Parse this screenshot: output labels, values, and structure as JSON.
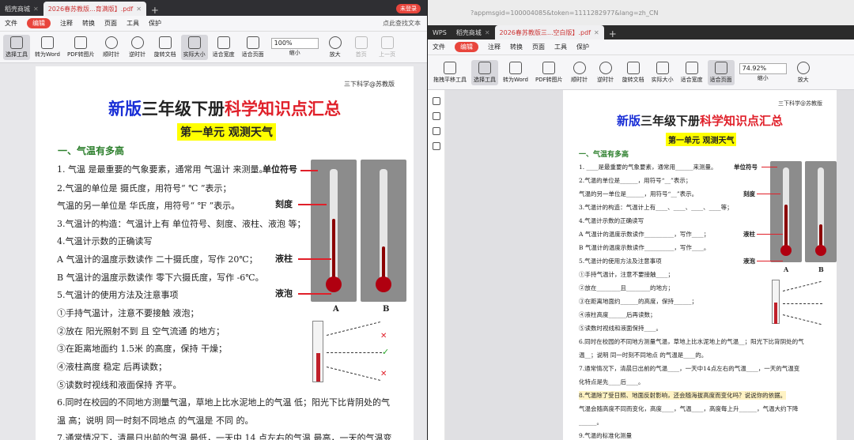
{
  "left": {
    "tabs": [
      "稻壳商城",
      "2026春苏教版...育满版】.pdf"
    ],
    "login": "未登录",
    "menu": [
      "文件",
      "编辑",
      "注释",
      "转换",
      "页面",
      "工具",
      "保护"
    ],
    "search": "点此查找文本",
    "tools": [
      "选择工具",
      "转为Word",
      "PDF转图片",
      "顺时针",
      "逆时针",
      "旋转文档",
      "实际大小",
      "适合宽度",
      "适合页面",
      "缩小",
      "放大",
      "首页",
      "上一页"
    ],
    "zoom": "100%",
    "doc": {
      "header": "三下科学@苏教版",
      "title_a": "新版",
      "title_b": "三年级下册",
      "title_c": "科学知识点汇总",
      "unit": "第一单元  观测天气",
      "section": "一、气温有多高",
      "lines": [
        "1.  气温 是最重要的气象要素，通常用 气温计 来测量。",
        "2.气温的单位是 摄氏度，用符号“ ℃ ”表示；",
        "   气温的另一单位是 华氏度，用符号“ ℉ ”表示。",
        "3.气温计的构造：气温计上有 单位符号、刻度、液柱、液泡 等；",
        "4.气温计示数的正确读写",
        "   A 气温计的温度示数读作 二十摄氏度，写作 20℃；",
        "   B 气温计的温度示数读作 零下六摄氏度，写作 -6℃。",
        "5.气温计的使用方法及注意事项",
        "   ①手持气温计，注意不要接触 液泡；",
        "   ②放在 阳光照射不到 且 空气流通 的地方；",
        "   ③在距离地面约 1.5米 的高度，保持 干燥；",
        "   ④液柱高度 稳定 后再读数；",
        "   ⑤读数时视线和液面保持 齐平。",
        "6.同时在校园的不同地方测量气温，草地上比水泥地上的气温 低；阳光下比背阴处的气",
        "温 高；说明 同一时刻不同地点 的气温是 不同 的。",
        "7.通常情况下，清晨日出前的气温 最低，一天中 14 点左右的气温 最高，一天的气温变"
      ],
      "labels": [
        "单位符号",
        "刻度",
        "液柱",
        "液泡"
      ],
      "thermo": [
        "A",
        "B"
      ],
      "scale": [
        "°F",
        "°C"
      ]
    }
  },
  "right": {
    "url": "?appmsgid=100004085&token=1111282977&lang=zh_CN",
    "tabs": [
      "WPS",
      "稻壳商城",
      "2026春苏教版三...空白版】.pdf"
    ],
    "menu": [
      "文件",
      "编辑",
      "注释",
      "转换",
      "页面",
      "工具",
      "保护"
    ],
    "tools": [
      "拖拽平移工具",
      "选择工具",
      "转为Word",
      "PDF转图片",
      "顺时针",
      "逆时针",
      "旋转文档",
      "实际大小",
      "适合宽度",
      "适合页面",
      "缩小",
      "放大"
    ],
    "zoom": "74.92%",
    "doc": {
      "header": "三下科学@苏教版",
      "title_a": "新版",
      "title_b": "三年级下册",
      "title_c": "科学知识点汇总",
      "unit": "第一单元  观测天气",
      "section": "一、气温有多高",
      "lines": [
        "1. ____是最重要的气象要素，通常用______来测量。",
        "2.气温的单位是______，用符号“__”表示；",
        "   气温的另一单位是______，用符号“__”表示。",
        "3.气温计的构造：气温计上有____、____、____、____等；",
        "4.气温计示数的正确读写",
        "   A 气温计的温度示数读作__________，写作____；",
        "   B 气温计的温度示数读作__________，写作____。",
        "5.气温计的使用方法及注意事项",
        "   ①手持气温计，注意不要接触____；",
        "   ②放在________且________的地方；",
        "   ③在距离地面约______的高度，保持______；",
        "   ④液柱高度______后再读数；",
        "   ⑤读数时视线和液面保持____。",
        "6.同时在校园的不同地方测量气温，草地上比水泥地上的气温__；阳光下比背阴处的气",
        "温__；说明 同一时刻不同地点 的气温是____的。",
        "7.通常情况下，清晨日出前的气温____，一天中14点左右的气温____，一天的气温变",
        "化特点是先____后____。",
        "8.气温除了受日照、地面反射影响，还会随海拔高度而变化吗？说说你的依据。",
        "   气温会随高度不同而变化，高度____，气温____，高度每上升______，气温大约下降",
        "______。",
        "9.气温的标准化测量"
      ],
      "labels": [
        "单位符号",
        "刻度",
        "液柱",
        "液泡"
      ],
      "thermo": [
        "A",
        "B"
      ]
    }
  }
}
